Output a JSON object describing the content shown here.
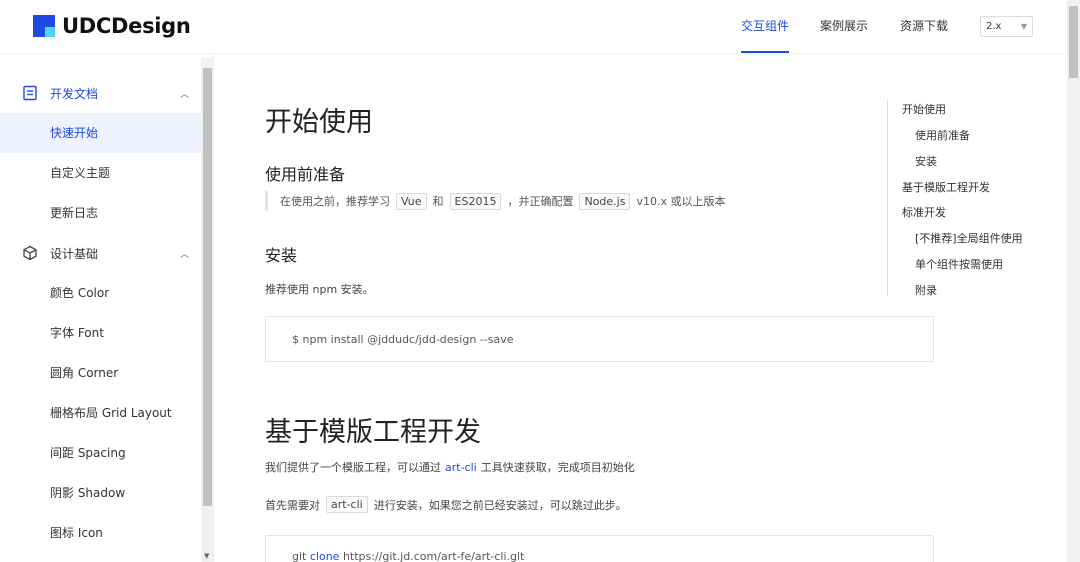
{
  "brand": {
    "name": "UDCDesign"
  },
  "nav": {
    "items": [
      {
        "label": "交互组件",
        "active": true
      },
      {
        "label": "案例展示",
        "active": false
      },
      {
        "label": "资源下载",
        "active": false
      }
    ],
    "version": "2.x"
  },
  "sidebar": {
    "groups": [
      {
        "label": "开发文档",
        "icon": "document-icon",
        "expanded": true,
        "items": [
          {
            "label": "快速开始",
            "active": true
          },
          {
            "label": "自定义主题",
            "active": false
          },
          {
            "label": "更新日志",
            "active": false
          }
        ]
      },
      {
        "label": "设计基础",
        "icon": "cube-icon",
        "expanded": true,
        "items": [
          {
            "label": "颜色 Color"
          },
          {
            "label": "字体 Font"
          },
          {
            "label": "圆角 Corner"
          },
          {
            "label": "栅格布局 Grid Layout"
          },
          {
            "label": "间距 Spacing"
          },
          {
            "label": "阴影 Shadow"
          },
          {
            "label": "图标 Icon"
          }
        ]
      }
    ]
  },
  "content": {
    "title": "开始使用",
    "prep": {
      "heading": "使用前准备",
      "text_1": "在使用之前，推荐学习",
      "tag_vue": "Vue",
      "text_and": "和",
      "tag_es": "ES2015",
      "text_2": "，并正确配置",
      "tag_node": "Node.js",
      "text_3": "v10.x 或以上版本"
    },
    "install": {
      "heading": "安装",
      "text": "推荐使用 npm 安装。",
      "command": "$ npm install @jddudc/jdd-design --save"
    },
    "template": {
      "title": "基于模版工程开发",
      "text_1a": "我们提供了一个模版工程，可以通过",
      "link": "art-cli",
      "text_1b": "工具快速获取，完成项目初始化",
      "text_2a": "首先需要对",
      "tag_cli": "art-cli",
      "text_2b": "进行安装，如果您之前已经安装过，可以跳过此步。",
      "code_git": "git",
      "code_clone": "clone",
      "code_url": "https://git.jd.com/art-fe/art-cli.git"
    }
  },
  "toc": {
    "items": [
      {
        "label": "开始使用",
        "level": 1
      },
      {
        "label": "使用前准备",
        "level": 2
      },
      {
        "label": "安装",
        "level": 2
      },
      {
        "label": "基于模版工程开发",
        "level": 1
      },
      {
        "label": "标准开发",
        "level": 1
      },
      {
        "label": "[不推荐]全局组件使用",
        "level": 2
      },
      {
        "label": "单个组件按需使用",
        "level": 2
      },
      {
        "label": "附录",
        "level": 2
      }
    ]
  }
}
